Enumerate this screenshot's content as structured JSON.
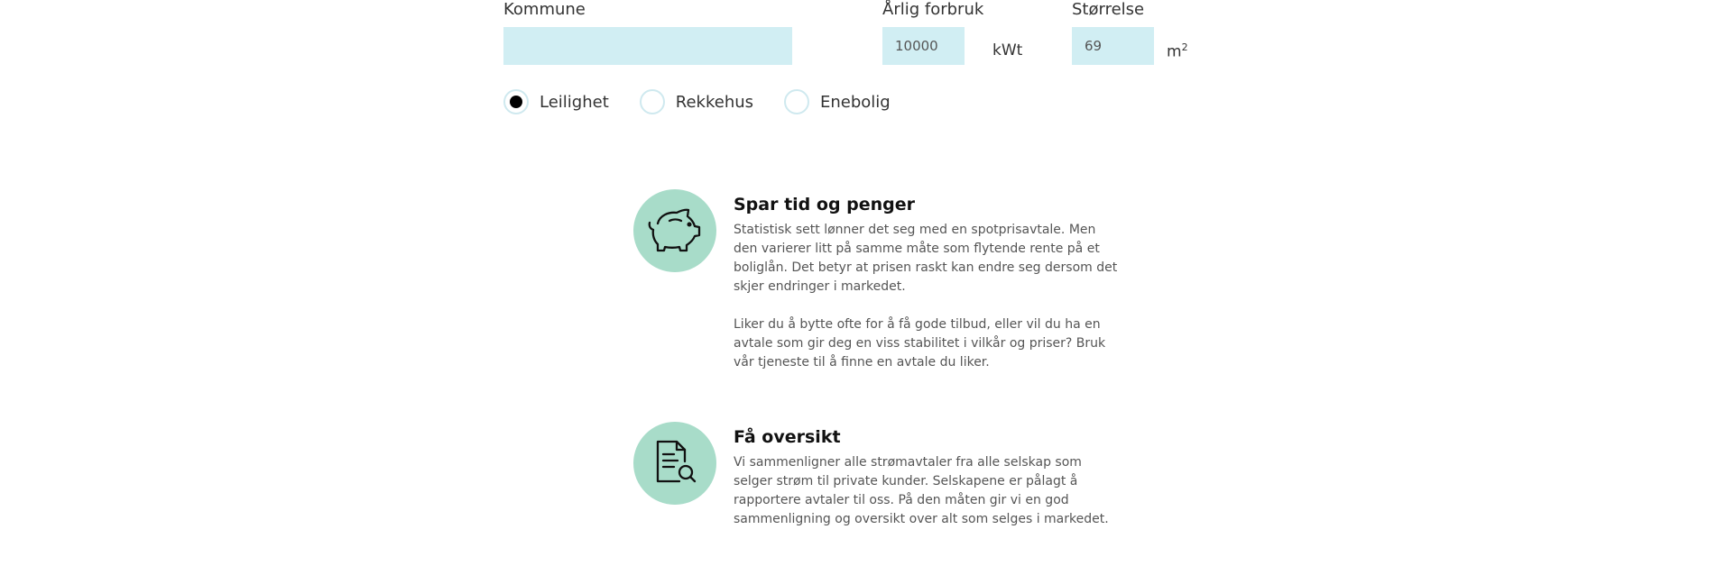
{
  "form": {
    "municipality": {
      "label": "Kommune",
      "value": "",
      "placeholder": ""
    },
    "annual_usage": {
      "label": "Årlig forbruk",
      "value": "10000",
      "unit": "kWt"
    },
    "size": {
      "label": "Størrelse",
      "value": "69",
      "unit": "m",
      "unit_sup": "2"
    },
    "housing_types": [
      {
        "label": "Leilighet",
        "selected": true
      },
      {
        "label": "Rekkehus",
        "selected": false
      },
      {
        "label": "Enebolig",
        "selected": false
      }
    ]
  },
  "features": [
    {
      "icon": "piggy-bank-icon",
      "title": "Spar tid og penger",
      "paragraphs": [
        "Statistisk sett lønner det seg med en spotprisavtale. Men den varierer litt på samme måte som flytende rente på et boliglån. Det betyr at prisen raskt kan endre seg dersom det skjer endringer i markedet.",
        "Liker du å bytte ofte for å få gode tilbud, eller vil du ha en avtale som gir deg en viss stabilitet i vilkår og priser? Bruk vår tjeneste til å finne en avtale du liker."
      ]
    },
    {
      "icon": "document-search-icon",
      "title": "Få oversikt",
      "paragraphs": [
        "Vi sammenligner alle strømavtaler fra alle selskap som selger strøm til private kunder. Selskapene er pålagt å rapportere avtaler til oss. På den måten gir vi en god sammenligning og oversikt over alt som selges i markedet."
      ]
    }
  ],
  "colors": {
    "input_bg": "#d1eef3",
    "icon_circle": "#a8dcc9",
    "radio_border": "#cfe9ef"
  }
}
